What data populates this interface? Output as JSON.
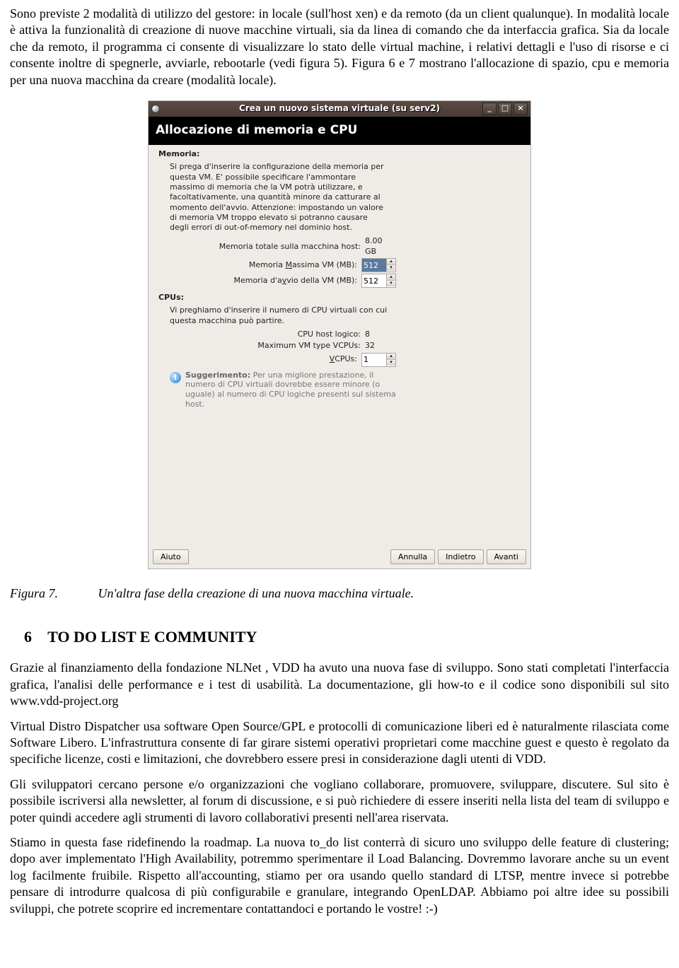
{
  "paragraphs": {
    "intro": "Sono previste 2 modalità di utilizzo del gestore: in locale (sull'host xen) e da remoto (da un client qualunque). In modalità locale è attiva la funzionalità di creazione di nuove macchine virtuali, sia da linea di comando che da interfaccia grafica. Sia da locale che da remoto, il programma ci consente di visualizzare lo stato delle virtual machine, i relativi dettagli e l'uso di risorse e ci consente inoltre di spegnerle, avviarle, rebootarle (vedi figura 5). Figura 6 e 7 mostrano l'allocazione di spazio, cpu e memoria per una nuova macchina da creare (modalità locale).",
    "p1": "Grazie al finanziamento della fondazione NLNet , VDD ha avuto una nuova fase di sviluppo. Sono stati completati l'interfaccia grafica, l'analisi delle performance e i test di usabilità.    La documentazione, gli how-to e il codice sono disponibili sul sito www.vdd-project.org",
    "p2": "Virtual Distro Dispatcher usa software Open Source/GPL e protocolli di comunicazione liberi ed è naturalmente rilasciata come Software Libero. L'infrastruttura consente di far girare sistemi operativi proprietari come macchine guest e questo è regolato da specifiche licenze, costi e limitazioni, che dovrebbero essere presi in considerazione dagli utenti di VDD.",
    "p3": "Gli sviluppatori cercano persone e/o organizzazioni che vogliano collaborare, promuovere, sviluppare, discutere. Sul sito è possibile iscriversi alla newsletter, al forum di discussione, e si può richiedere di essere inseriti nella lista del team di sviluppo e poter quindi accedere agli strumenti di lavoro collaborativi presenti nell'area riservata.",
    "p4": "Stiamo in questa fase ridefinendo la roadmap. La nuova to_do list conterrà di sicuro uno sviluppo delle feature di clustering; dopo aver implementato l'High Availability, potremmo sperimentare il Load Balancing. Dovremmo lavorare anche su un event log facilmente fruibile. Rispetto all'accounting, stiamo per ora usando quello standard di LTSP, mentre invece si potrebbe pensare di introdurre qualcosa di più configurabile e granulare, integrando OpenLDAP. Abbiamo poi altre idee su possibili sviluppi, che potrete scoprire ed incrementare contattandoci e portando le vostre! :-)"
  },
  "figure": {
    "label": "Figura 7.",
    "caption": "Un'altra fase della creazione di una nuova macchina virtuale."
  },
  "section": {
    "num": "6",
    "title": "TO DO LIST E COMMUNITY"
  },
  "dialog": {
    "title": "Crea un nuovo sistema virtuale (su serv2)",
    "header": "Allocazione di memoria e CPU",
    "memory": {
      "label": "Memoria:",
      "info": "Si prega d'inserire la configurazione della memoria per questa VM. E' possibile specificare l'ammontare massimo di memoria che la VM potrà utilizzare, e facoltativamente, una quantità minore da catturare al momento dell'avvio. Attenzione: impostando un valore di memoria VM troppo elevato si potranno causare degli errori di out-of-memory nel dominio host.",
      "total_label": "Memoria totale sulla macchina host:",
      "total_value": "8.00 GB",
      "max_label_pre": "Memoria ",
      "max_label_u": "M",
      "max_label_post": "assima VM (MB):",
      "max_value": "512",
      "start_label_pre": "Memoria d'a",
      "start_label_u": "v",
      "start_label_post": "vio della VM (MB):",
      "start_value": "512"
    },
    "cpus": {
      "label": "CPUs:",
      "info": "Vi preghiamo d'inserire il numero di CPU virtuali con cui questa macchina può partire.",
      "host_label": "CPU host logico:",
      "host_value": "8",
      "max_label": "Maximum VM type VCPUs:",
      "max_value": "32",
      "v_label_u": "V",
      "v_label_post": "CPUs:",
      "v_value": "1",
      "hint_bold": "Suggerimento:",
      "hint_text": " Per una migliore prestazione, il numero di CPU virtuali dovrebbe essere minore (o uguale) al numero di CPU logiche presenti sul sistema host."
    },
    "buttons": {
      "help": "Aiuto",
      "cancel": "Annulla",
      "back": "Indietro",
      "forward": "Avanti"
    },
    "window": {
      "min": "_",
      "max": "□",
      "close": "×"
    }
  }
}
